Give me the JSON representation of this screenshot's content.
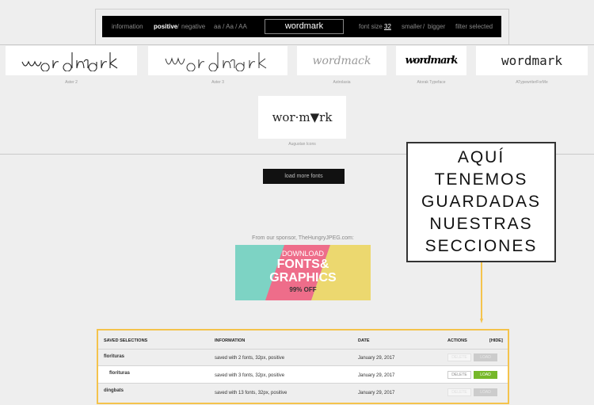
{
  "toolbar": {
    "information": "information",
    "positive": "positive",
    "slash1": "/",
    "negative": "negative",
    "cases": "aa / Aa / AA",
    "wordmark": "wordmark",
    "font_size_label": "font size",
    "font_size_value": "32",
    "smaller": "smaller",
    "slash2": "/",
    "bigger": "bigger",
    "filter": "filter selected"
  },
  "fonts": [
    {
      "preview": "wordmark",
      "name": "Aster 2"
    },
    {
      "preview": "wordmark",
      "name": "Aster 3"
    },
    {
      "preview": "wordmack",
      "name": "Astrolasia"
    },
    {
      "preview": "wordmark",
      "name": "Atorak Typeface"
    },
    {
      "preview": "wordmark",
      "name": "ATypewriterForMe"
    },
    {
      "preview": "wor·m▼rk",
      "name": "Augustan Icons"
    }
  ],
  "load_more": "load more fonts",
  "sponsor": {
    "text": "From our sponsor, TheHungryJPEG.com:",
    "banner_line1": "DOWNLOAD",
    "banner_line2": "FONTS&",
    "banner_line3": "GRAPHICS",
    "banner_line4": "99% OFF"
  },
  "callout": [
    "AQUÍ",
    "TENEMOS",
    "GUARDADAS",
    "NUESTRAS",
    "SECCIONES"
  ],
  "saved": {
    "headers": {
      "name": "SAVED SELECTIONS",
      "info": "INFORMATION",
      "date": "DATE",
      "actions": "ACTIONS",
      "hide": "[HIDE]"
    },
    "delete_label": "DELETE",
    "load_label": "LOAD",
    "rows": [
      {
        "name": "florituras",
        "info": "saved with 2 fonts, 32px, positive",
        "date": "January 29, 2017"
      },
      {
        "name": "florituras",
        "info": "saved with 3 fonts, 32px, positive",
        "date": "January 29, 2017"
      },
      {
        "name": "dingbats",
        "info": "saved with 13 fonts, 32px, positive",
        "date": "January 29, 2017"
      }
    ]
  },
  "colors": {
    "accent_green": "#76b82a",
    "highlight_yellow": "#f4c34c"
  }
}
